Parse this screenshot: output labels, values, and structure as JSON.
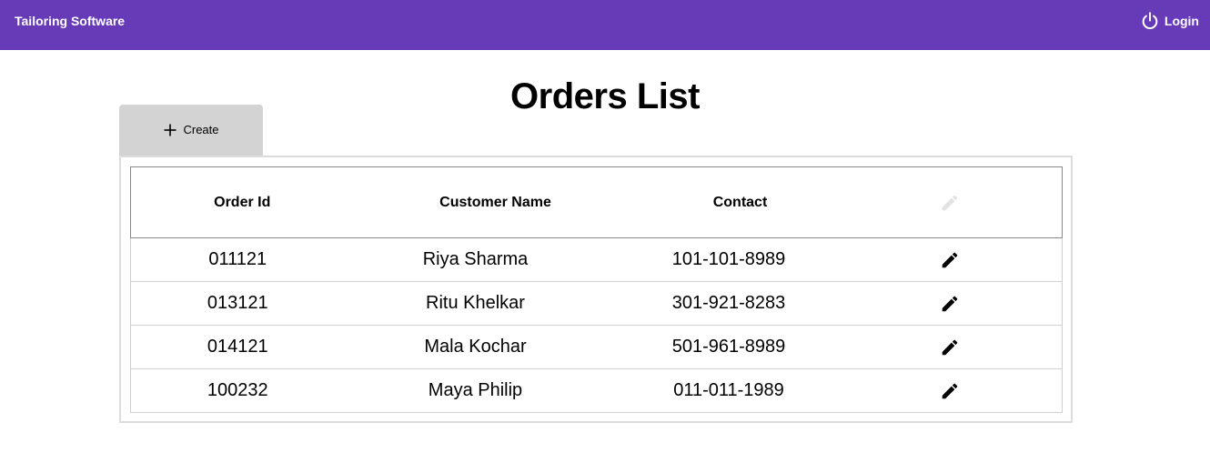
{
  "app": {
    "title": "Tailoring Software",
    "login_label": "Login",
    "accent": "#673ab7"
  },
  "page": {
    "title": "Orders List",
    "create_label": "Create"
  },
  "table": {
    "headers": {
      "order_id": "Order Id",
      "customer_name": "Customer Name",
      "contact": "Contact",
      "edit": "edit-icon"
    },
    "rows": [
      {
        "order_id": "011121",
        "customer_name": "Riya Sharma",
        "contact": "101-101-8989"
      },
      {
        "order_id": "013121",
        "customer_name": "Ritu Khelkar",
        "contact": "301-921-8283"
      },
      {
        "order_id": "014121",
        "customer_name": "Mala Kochar",
        "contact": "501-961-8989"
      },
      {
        "order_id": "100232",
        "customer_name": "Maya Philip",
        "contact": "011-011-1989"
      }
    ]
  },
  "icons": {
    "login": "power-icon",
    "create": "plus-icon",
    "row_action": "edit-icon"
  }
}
